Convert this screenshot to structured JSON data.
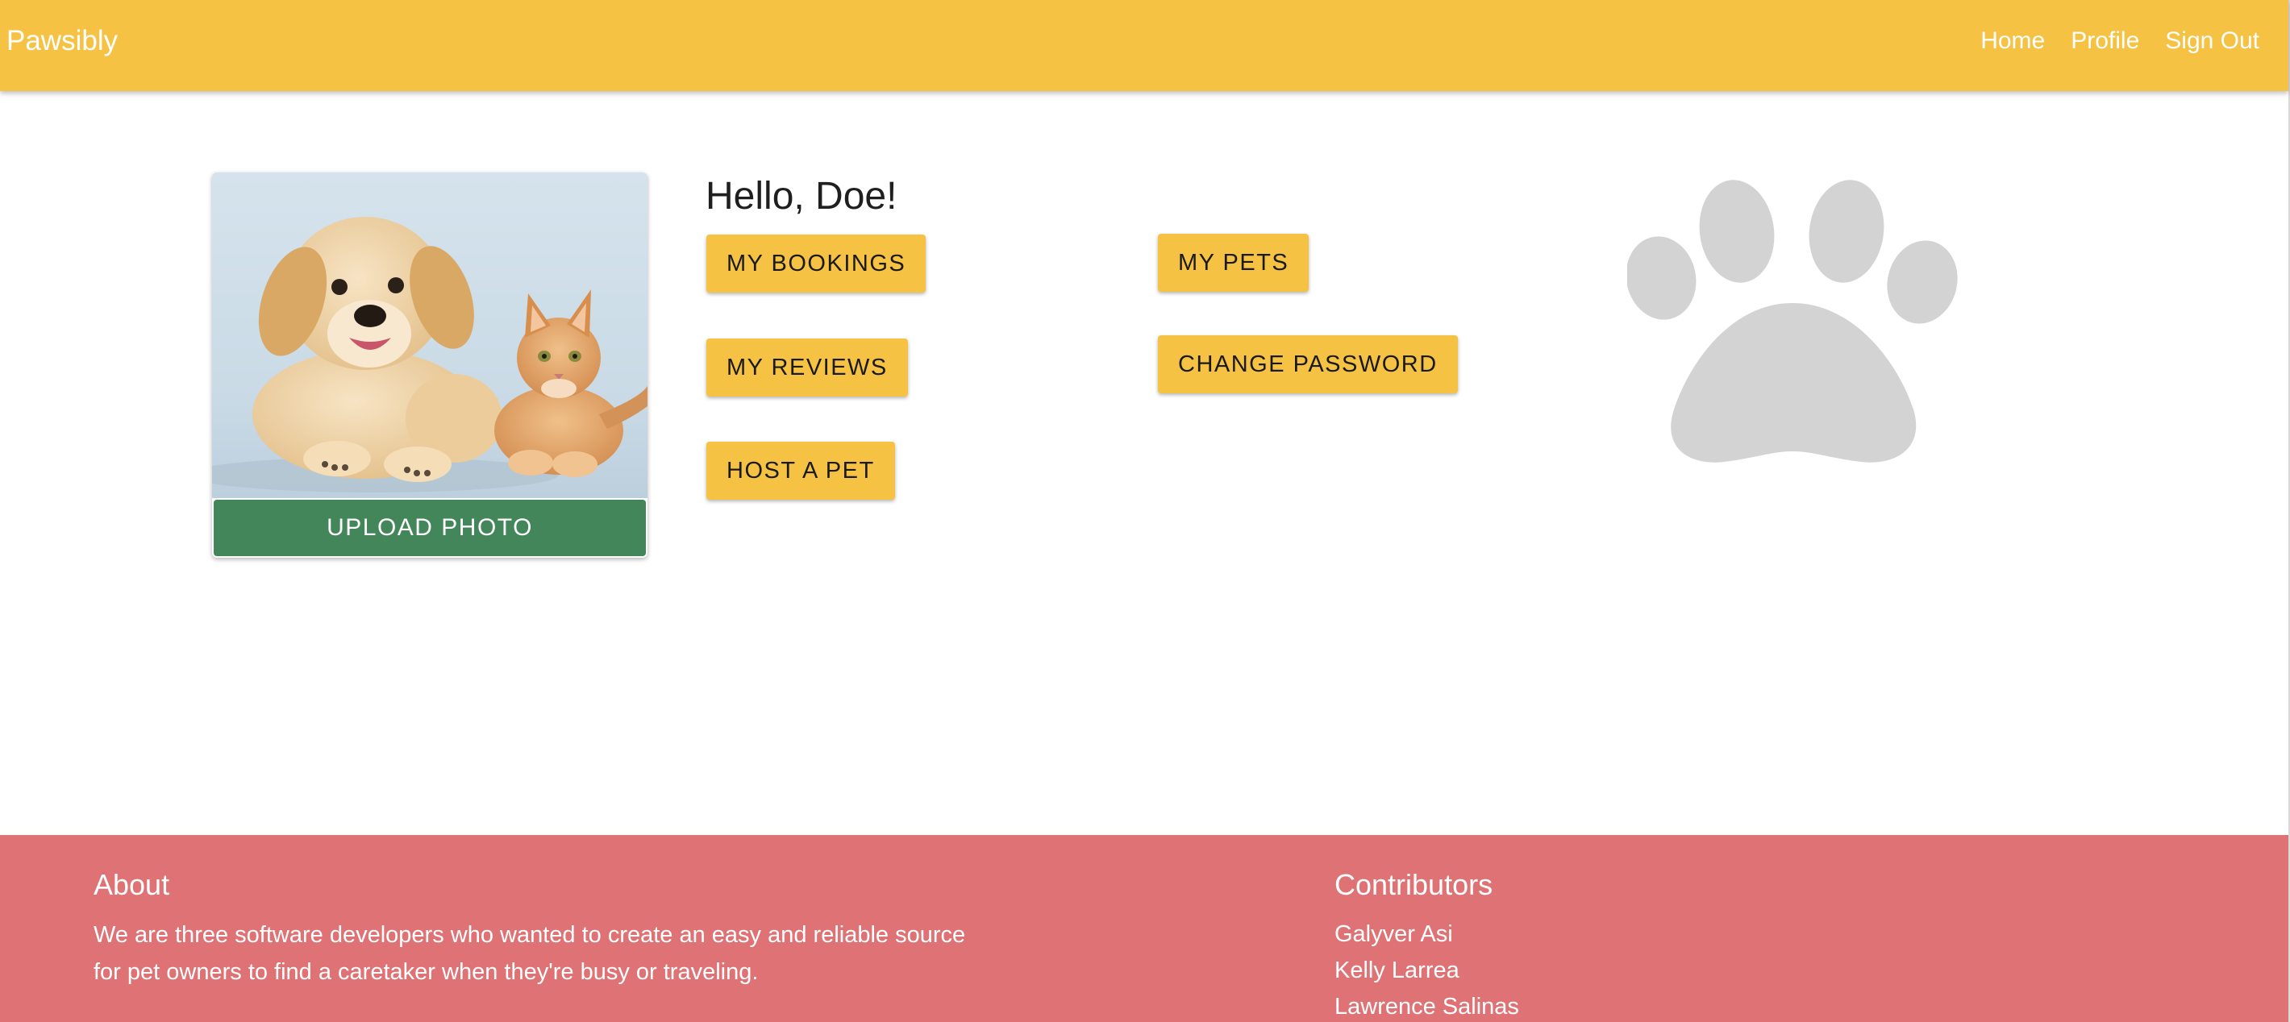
{
  "navbar": {
    "brand": "Pawsibly",
    "links": [
      "Home",
      "Profile",
      "Sign Out"
    ]
  },
  "profile": {
    "greeting": "Hello, Doe!",
    "photo_alt": "puppy and kitten photo",
    "upload_label": "UPLOAD PHOTO",
    "actions": {
      "my_bookings": "MY BOOKINGS",
      "my_reviews": "MY REVIEWS",
      "host_a_pet": "HOST A PET",
      "my_pets": "MY PETS",
      "change_password": "CHANGE PASSWORD"
    },
    "decor_icon": "paw-print-icon"
  },
  "footer": {
    "about_title": "About",
    "about_text": "We are three software developers who wanted to create an easy and reliable source for pet owners to find a caretaker when they're busy or traveling.",
    "contributors_title": "Contributors",
    "contributors": [
      "Galyver Asi",
      "Kelly Larrea",
      "Lawrence Salinas"
    ]
  },
  "colors": {
    "navbar": "#f6c244",
    "button_accent": "#f6c244",
    "upload_button": "#43865a",
    "footer": "#de7274",
    "paw": "#d3d3d3"
  }
}
